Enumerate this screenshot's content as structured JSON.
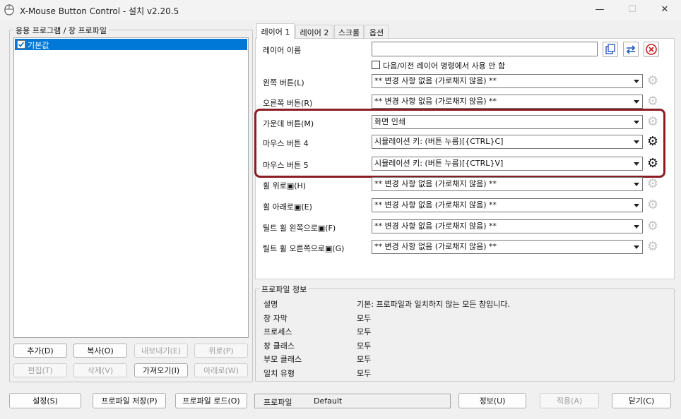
{
  "window": {
    "title": "X-Mouse Button Control - 설치 v2.20.5",
    "controls": {
      "minimize": "—",
      "maximize": "☐",
      "close": "✕"
    }
  },
  "left_panel": {
    "group_label": "응용 프로그램 / 창 프로파일",
    "items": [
      {
        "label": "기본값",
        "checked": true,
        "selected": true
      }
    ],
    "buttons": {
      "add": "추가(D)",
      "copy": "복사(O)",
      "export": "내보내기(E)",
      "up": "위로(P)",
      "edit": "편집(T)",
      "delete": "삭제(V)",
      "import": "가져오기(I)",
      "down": "아래로(W)"
    }
  },
  "tabs": [
    "레이어 1",
    "레이어 2",
    "스크롤",
    "옵션"
  ],
  "layer": {
    "name_label": "레이어 이름",
    "name_value": "",
    "checkbox_label": "다음/이전 레이어 명령에서 사용 안 함",
    "rows": [
      {
        "label": "왼쪽 버튼(L)",
        "value": "** 변경 사항 없음 (가로채지 않음) **",
        "gear_active": false
      },
      {
        "label": "오른쪽 버튼(R)",
        "value": "** 변경 사항 없음 (가로채지 않음) **",
        "gear_active": false
      },
      {
        "label": "가운데 버튼(M)",
        "value": "화면 인쇄",
        "gear_active": false
      },
      {
        "label": "마우스 버튼 4",
        "value": "시뮬레이션 키: (버튼 누름)[{CTRL}C]",
        "gear_active": true
      },
      {
        "label": "마우스 버튼 5",
        "value": "시뮬레이션 키: (버튼 누름)[{CTRL}V]",
        "gear_active": true
      },
      {
        "label": "휠 위로▣(H)",
        "value": "** 변경 사항 없음 (가로채지 않음) **",
        "gear_active": false
      },
      {
        "label": "휠 아래로▣(E)",
        "value": "** 변경 사항 없음 (가로채지 않음) **",
        "gear_active": false
      },
      {
        "label": "틸트 휠 왼쪽으로▣(F)",
        "value": "** 변경 사항 없음 (가로채지 않음) **",
        "gear_active": false
      },
      {
        "label": "틸트 휠 오른쪽으로▣(G)",
        "value": "** 변경 사항 없음 (가로채지 않음) **",
        "gear_active": false
      }
    ],
    "highlight_color": "#8b1c22",
    "accent_color": "#0078d7"
  },
  "profile_info": {
    "group_label": "프로파일 정보",
    "rows": [
      {
        "key": "설명",
        "value": "기본: 프로파일과 일치하지 않는 모든 창입니다."
      },
      {
        "key": "창 자막",
        "value": "모두"
      },
      {
        "key": "프로세스",
        "value": "모두"
      },
      {
        "key": "창 클래스",
        "value": "모두"
      },
      {
        "key": "부모 클래스",
        "value": "모두"
      },
      {
        "key": "일치 유형",
        "value": "모두"
      }
    ]
  },
  "footer": {
    "settings": "설정(S)",
    "save_profile": "프로파일 저장(P)",
    "load_profile": "프로파일 로드(O)",
    "profile_label": "프로파일",
    "profile_value": "Default",
    "info": "정보(U)",
    "apply": "적용(A)",
    "close": "닫기(C)"
  }
}
